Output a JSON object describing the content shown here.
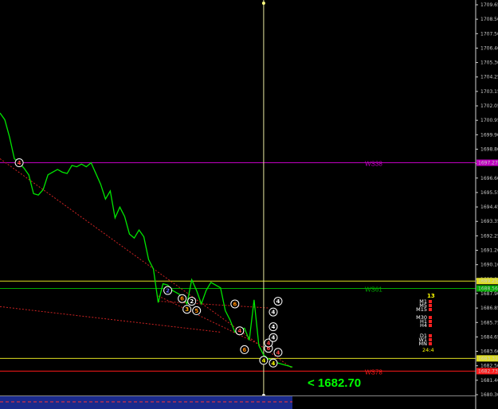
{
  "chart_data": {
    "type": "line",
    "title": "",
    "xlabel": "",
    "ylabel": "",
    "ylim": [
      1680.65,
      1709.65
    ],
    "price_axis_ticks": [
      "1709.65",
      "1708.50",
      "1707.50",
      "1706.40",
      "1705.30",
      "1704.25",
      "1703.15",
      "1702.05",
      "1700.95",
      "1699.90",
      "1698.80",
      "1697.70",
      "1696.60",
      "1695.55",
      "1694.45",
      "1693.35",
      "1692.25",
      "1691.20",
      "1690.10",
      "1689.00",
      "1687.90",
      "1686.85",
      "1685.75",
      "1684.65",
      "1683.60",
      "1682.50",
      "1681.40",
      "1680.30"
    ],
    "series": [
      {
        "color": "#00e600",
        "x": [
          0,
          1,
          2,
          3,
          4,
          5,
          6,
          7,
          8,
          9,
          10,
          11,
          12,
          13,
          14,
          15,
          16,
          17,
          18,
          19,
          20,
          21,
          22,
          23,
          24,
          25,
          26,
          27,
          28,
          29,
          30,
          31,
          32,
          33,
          34,
          35,
          36,
          37,
          38,
          39,
          40,
          41,
          42,
          43,
          44,
          45,
          46,
          47,
          48,
          49,
          50,
          51,
          52,
          53,
          54,
          55,
          56,
          57,
          58,
          59,
          60,
          61
        ],
        "y": [
          1701.6,
          1701.1,
          1699.8,
          1698.2,
          1697.9,
          1697.5,
          1697.0,
          1695.6,
          1695.5,
          1695.9,
          1697.0,
          1697.2,
          1697.4,
          1697.2,
          1697.1,
          1697.7,
          1697.6,
          1697.8,
          1697.6,
          1697.9,
          1697.1,
          1696.3,
          1695.2,
          1695.8,
          1693.8,
          1694.6,
          1693.9,
          1692.6,
          1692.3,
          1692.9,
          1692.4,
          1690.7,
          1690.0,
          1687.5,
          1688.9,
          1688.8,
          1688.4,
          1688.2,
          1688.0,
          1687.4,
          1689.2,
          1688.4,
          1687.4,
          1688.4,
          1689.0,
          1688.8,
          1688.6,
          1686.9,
          1686.2,
          1685.3,
          1685.5,
          1685.6,
          1684.7,
          1687.7,
          1684.3,
          1683.6,
          1683.3,
          1683.2,
          1683.0,
          1682.9,
          1682.8,
          1682.7
        ]
      }
    ],
    "hlines": [
      {
        "price": 1697.9,
        "label": "WS38",
        "axis_label": "1697.27",
        "color": "#c000c0",
        "label_color": "#c000c0"
      },
      {
        "price": 1689.1,
        "label": "",
        "axis_label": "1689.25",
        "color": "#dddd22",
        "label_color": "#dddd22"
      },
      {
        "price": 1688.55,
        "label": "WS61",
        "axis_label": "1688.56",
        "color": "#00aa00",
        "label_color": "#00aa00"
      },
      {
        "price": 1683.35,
        "label": "",
        "axis_label": "1683.32",
        "color": "#dddd22",
        "label_color": "#dddd22"
      },
      {
        "price": 1682.4,
        "label": "WS78",
        "axis_label": "1682.73",
        "color": "#ff1a1a",
        "label_color": "#ff1a1a"
      }
    ],
    "trendlines": [
      {
        "from": [
          0,
          1698.2
        ],
        "to": [
          61,
          1682.6
        ],
        "color": "#cc2222",
        "style": "dotted"
      },
      {
        "from": [
          0,
          1687.2
        ],
        "to": [
          46,
          1685.3
        ],
        "color": "#cc2222",
        "style": "dotted"
      },
      {
        "from": [
          33,
          1687.6
        ],
        "to": [
          56,
          1687.1
        ],
        "color": "#cc2222",
        "style": "dotted"
      },
      {
        "from": [
          33,
          1688.0
        ],
        "to": [
          54,
          1684.4
        ],
        "color": "#cc2222",
        "style": "dotted"
      }
    ],
    "markers": [
      {
        "x": 4,
        "y": 1697.9,
        "label": "4",
        "color": "#ff4444"
      },
      {
        "x": 35,
        "y": 1688.4,
        "label": "2",
        "color": "#6666ff"
      },
      {
        "x": 38,
        "y": 1687.8,
        "label": "6",
        "color": "#ff8800"
      },
      {
        "x": 39,
        "y": 1687.0,
        "label": "3",
        "color": "#ffaa00"
      },
      {
        "x": 40,
        "y": 1687.6,
        "label": "2",
        "color": "#ffffff"
      },
      {
        "x": 41,
        "y": 1686.9,
        "label": "5",
        "color": "#ff8800"
      },
      {
        "x": 49,
        "y": 1687.4,
        "label": "6",
        "color": "#ff8800"
      },
      {
        "x": 50,
        "y": 1685.4,
        "label": "4",
        "color": "#ff4444"
      },
      {
        "x": 51,
        "y": 1684.0,
        "label": "6",
        "color": "#ff8800"
      },
      {
        "x": 55,
        "y": 1683.2,
        "label": "4",
        "color": "#ffff00"
      },
      {
        "x": 56,
        "y": 1684.1,
        "label": "6",
        "color": "#ff4444"
      },
      {
        "x": 56,
        "y": 1684.5,
        "label": "4",
        "color": "#ff4444"
      },
      {
        "x": 57,
        "y": 1683.0,
        "label": "4",
        "color": "#ffff00"
      },
      {
        "x": 57,
        "y": 1686.8,
        "label": "4",
        "color": "#ffffff"
      },
      {
        "x": 57,
        "y": 1685.7,
        "label": "4",
        "color": "#ffffff"
      },
      {
        "x": 57,
        "y": 1684.9,
        "label": "4",
        "color": "#ffffff"
      },
      {
        "x": 58,
        "y": 1683.8,
        "label": "4",
        "color": "#ff4444"
      },
      {
        "x": 58,
        "y": 1687.6,
        "label": "4",
        "color": "#ffffff"
      }
    ],
    "crosshair": {
      "x": 55
    },
    "grid": false,
    "background": "#000000"
  },
  "timeframe_panel": {
    "count": "13",
    "labels": [
      "M1",
      "M5",
      "M15",
      "M30",
      "H1",
      "H4",
      "D1",
      "W1",
      "MN"
    ],
    "timer": "24:4"
  },
  "current_price_label": "<  1682.70",
  "colors": {
    "bullet_up": "#ff2020",
    "bottom_bar": "#1a2a8c",
    "bottom_bar_dash": "#ff3333"
  }
}
